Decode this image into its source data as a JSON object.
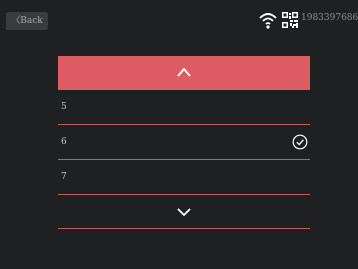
{
  "header": {
    "back_label": "〈Back",
    "device_id": "1983397686"
  },
  "picker": {
    "options": [
      {
        "label": "5",
        "selected": false
      },
      {
        "label": "6",
        "selected": true
      },
      {
        "label": "7",
        "selected": false
      }
    ]
  },
  "colors": {
    "background": "#1f2021",
    "accent": "#dd5c63",
    "divider": "#c45c63",
    "text": "#c2c3c5",
    "icon": "#ffffff"
  },
  "icons": {
    "up": "chevron-up-icon",
    "down": "chevron-down-icon",
    "selected": "check-circle-icon",
    "wifi": "wifi-icon",
    "qr": "qr-code-icon"
  }
}
